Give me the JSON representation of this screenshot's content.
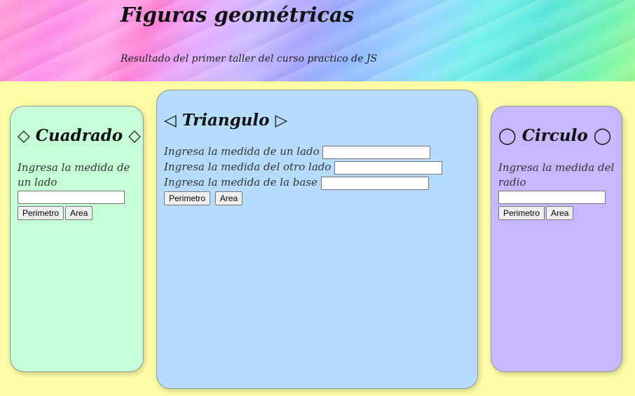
{
  "header": {
    "title": "Figuras geométricas",
    "subtitle": "Resultado del primer taller del curso practico de JS"
  },
  "square": {
    "title": "◇ Cuadrado ◇",
    "label": "Ingresa la medida de un lado",
    "input_value": "",
    "perimeter_button": "Perimetro",
    "area_button": "Area",
    "background": "#c5fdd6"
  },
  "triangle": {
    "title": "◁ Triangulo ▷",
    "label_side1": "Ingresa la medida de un lado",
    "label_side2": "Ingresa la medida del otro lado",
    "label_base": "Ingresa la medida de la base",
    "input_side1_value": "",
    "input_side2_value": "",
    "input_base_value": "",
    "perimeter_button": "Perimetro",
    "area_button": "Area",
    "background": "#b5dcfc"
  },
  "circle": {
    "title": "◯ Circulo ◯",
    "label": "Ingresa la medida del radio",
    "input_value": "",
    "perimeter_button": "Perimetro",
    "area_button": "Area",
    "background": "#c7b7fc"
  },
  "colors": {
    "page_background": "#fdfca6"
  }
}
